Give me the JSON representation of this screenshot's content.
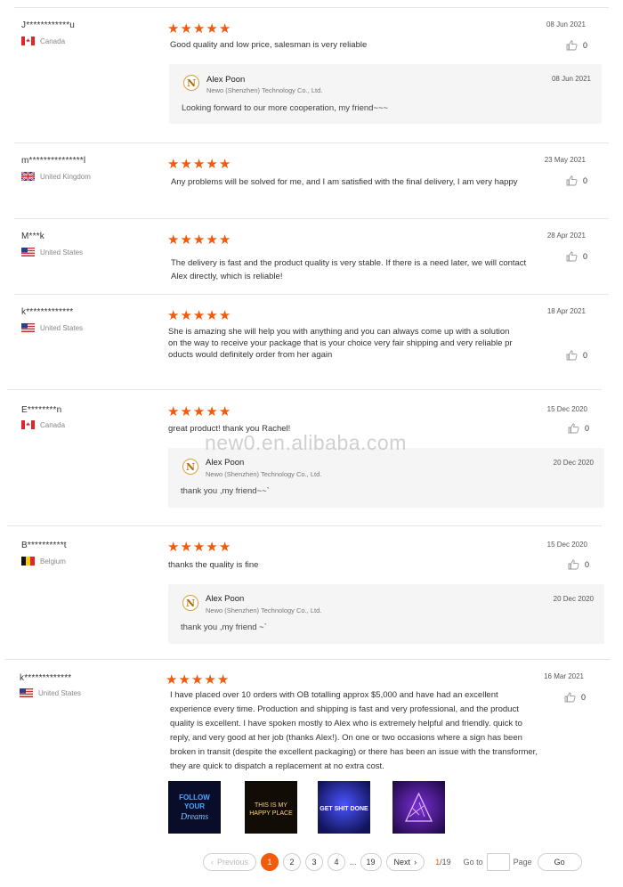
{
  "watermark": "new0.en.alibaba.com",
  "stars_glyph": "★",
  "like_icon": "thumbs-up-icon",
  "colors": {
    "star": "#f25a0c",
    "active_page": "#f25a0c",
    "divider": "#e6e6e6",
    "reply_bg": "#f5f5f5"
  },
  "reviews": [
    {
      "user": "J************u",
      "country": "Canada",
      "flag": "canada",
      "date": "08 Jun 2021",
      "text": "Good quality and low price, salesman is very reliable",
      "likes": "0",
      "reply": {
        "name": "Alex Poon",
        "company": "Newo (Shenzhen) Technology Co., Ltd.",
        "date": "08 Jun 2021",
        "text": "Looking forward to our more cooperation, my friend~~~"
      }
    },
    {
      "user": "m***************l",
      "country": "United Kingdom",
      "flag": "uk",
      "date": "23 May 2021",
      "text": "Any problems will be solved for me, and I am satisfied with the final delivery, I am very happy",
      "likes": "0"
    },
    {
      "user": "M***k",
      "country": "United States",
      "flag": "us",
      "date": "28 Apr 2021",
      "text_lines": [
        "The delivery is fast and the product quality is very stable. If there is a need later, we will contact",
        "Alex directly, which is reliable!"
      ],
      "likes": "0"
    },
    {
      "user": "k*************",
      "country": "United States",
      "flag": "us",
      "date": "18 Apr 2021",
      "text_lines": [
        "She is amazing she will help you with anything and you can always come up with a solution",
        "on the way to receive your package that is your choice very fair shipping and very reliable pr",
        "oducts would definitely order from her again"
      ],
      "likes": "0"
    },
    {
      "user": "E********n",
      "country": "Canada",
      "flag": "canada",
      "date": "15 Dec 2020",
      "text": "great product! thank you Rachel!",
      "likes": "0",
      "reply": {
        "name": "Alex Poon",
        "company": "Newo (Shenzhen) Technology Co., Ltd.",
        "date": "20 Dec 2020",
        "text": "thank you ,my friend~~`"
      }
    },
    {
      "user": "B**********t",
      "country": "Belgium",
      "flag": "belgium",
      "date": "15 Dec 2020",
      "text": "thanks the quality is fine",
      "likes": "0",
      "reply": {
        "name": "Alex Poon",
        "company": "Newo (Shenzhen) Technology Co., Ltd.",
        "date": "20 Dec 2020",
        "text": "thank you ,my friend ~`"
      }
    },
    {
      "user": "k*************",
      "country": "United States",
      "flag": "us",
      "date": "16 Mar 2021",
      "text_lines": [
        "I have placed over 10 orders with OB totalling approx $5,000 and have had an excellent",
        "experience every time. Production and shipping is fast and very professional, and the product",
        "quality is excellent. I have spoken mostly to Alex who is extremely helpful and friendly. quick to",
        "reply, and very good at her job (thanks Alex!). On one or two occasions where a sign has been",
        "broken in transit (despite the excellent packaging) or there has been an issue with the transformer,",
        "they are quick to dispatch a replacement at no extra cost."
      ],
      "likes": "0",
      "photos": [
        {
          "caption_lines": [
            "FOLLOW",
            "YOUR",
            "Dreams"
          ]
        },
        {
          "caption_lines": [
            "THIS IS MY",
            "HAPPY PLACE"
          ]
        },
        {
          "caption_lines": [
            "GET SHIT DONE"
          ]
        },
        {
          "caption_lines": []
        }
      ]
    }
  ],
  "pagination": {
    "prev": "Previous",
    "pages": [
      "1",
      "2",
      "3",
      "4"
    ],
    "ellipsis": "...",
    "last": "19",
    "next": "Next",
    "current": "1",
    "total": "/19",
    "goto_label": "Go to",
    "page_label": "Page",
    "go": "Go"
  }
}
